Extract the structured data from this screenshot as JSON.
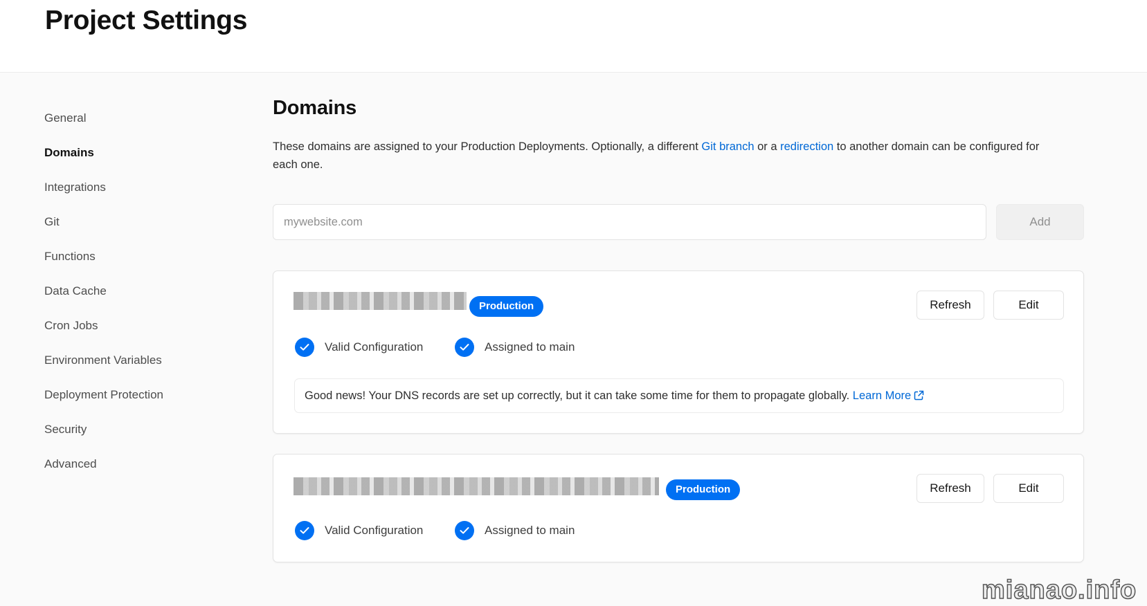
{
  "header": {
    "title": "Project Settings"
  },
  "sidebar": {
    "items": [
      {
        "label": "General",
        "active": false
      },
      {
        "label": "Domains",
        "active": true
      },
      {
        "label": "Integrations",
        "active": false
      },
      {
        "label": "Git",
        "active": false
      },
      {
        "label": "Functions",
        "active": false
      },
      {
        "label": "Data Cache",
        "active": false
      },
      {
        "label": "Cron Jobs",
        "active": false
      },
      {
        "label": "Environment Variables",
        "active": false
      },
      {
        "label": "Deployment Protection",
        "active": false
      },
      {
        "label": "Security",
        "active": false
      },
      {
        "label": "Advanced",
        "active": false
      }
    ]
  },
  "domains": {
    "title": "Domains",
    "description_pre": "These domains are assigned to your Production Deployments. Optionally, a different ",
    "git_branch_link": "Git branch",
    "description_mid": " or a ",
    "redirection_link": "redirection",
    "description_post": " to another domain can be configured for each one.",
    "input_placeholder": "mywebsite.com",
    "input_value": "",
    "add_label": "Add",
    "cards": [
      {
        "badge": "Production",
        "refresh_label": "Refresh",
        "edit_label": "Edit",
        "status_valid": "Valid Configuration",
        "status_assigned": "Assigned to main",
        "info_text": "Good news! Your DNS records are set up correctly, but it can take some time for them to propagate globally.",
        "info_link": "Learn More"
      },
      {
        "badge": "Production",
        "refresh_label": "Refresh",
        "edit_label": "Edit",
        "status_valid": "Valid Configuration",
        "status_assigned": "Assigned to main"
      }
    ]
  },
  "watermark": "mianao.info",
  "colors": {
    "accent": "#0070f3",
    "link": "#0068d6"
  },
  "icons": [
    "check-circle-icon",
    "external-link-icon"
  ]
}
